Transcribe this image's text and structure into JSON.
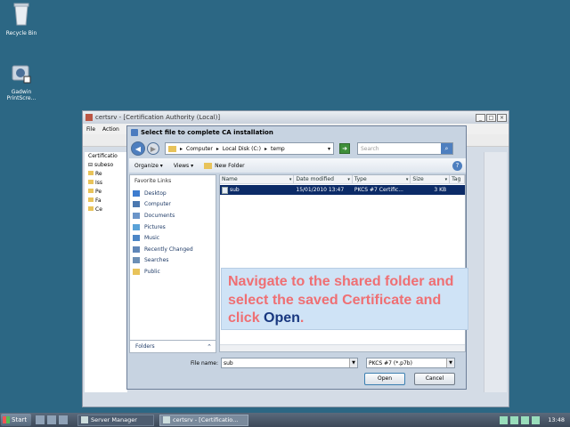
{
  "desktop": {
    "icons": [
      {
        "label": "Recycle Bin"
      },
      {
        "label": "Gadwin PrintScre..."
      }
    ]
  },
  "mmc": {
    "title": "certsrv - [Certification Authority (Local)]",
    "menu": [
      "File",
      "Action"
    ],
    "tree": [
      "Certificatio",
      "subeso",
      "Re",
      "Iss",
      "Pe",
      "Fa",
      "Ce"
    ]
  },
  "dialog": {
    "title": "Select file to complete CA installation",
    "breadcrumb": [
      "Computer",
      "Local Disk (C:)",
      "temp"
    ],
    "search_placeholder": "Search",
    "toolbar": {
      "organize": "Organize",
      "views": "Views",
      "new_folder": "New Folder"
    },
    "favorites_header": "Favorite Links",
    "favorites": [
      {
        "label": "Desktop",
        "icon": "desktop-icon",
        "color": "#3d7ccf"
      },
      {
        "label": "Computer",
        "icon": "computer-icon",
        "color": "#4b79b0"
      },
      {
        "label": "Documents",
        "icon": "documents-icon",
        "color": "#6b95c9"
      },
      {
        "label": "Pictures",
        "icon": "pictures-icon",
        "color": "#5aa2d8"
      },
      {
        "label": "Music",
        "icon": "music-icon",
        "color": "#4c86c6"
      },
      {
        "label": "Recently Changed",
        "icon": "recent-icon",
        "color": "#5f86b8"
      },
      {
        "label": "Searches",
        "icon": "searches-icon",
        "color": "#6c8fb5"
      },
      {
        "label": "Public",
        "icon": "folder-icon",
        "color": "#e8c35a"
      }
    ],
    "folders_label": "Folders",
    "columns": [
      "Name",
      "Date modified",
      "Type",
      "Size",
      "Tag"
    ],
    "files": [
      {
        "name": "sub",
        "date": "15/01/2010 13:47",
        "type": "PKCS #7 Certific...",
        "size": "3 KB",
        "tags": ""
      }
    ],
    "filename_label": "File name:",
    "filename_value": "sub",
    "filetype_value": "PKCS #7 (*.p7b)",
    "open_label": "Open",
    "cancel_label": "Cancel"
  },
  "callout": {
    "text_before": "Navigate to the shared folder and select the saved Certificate and click ",
    "highlight": "Open",
    "text_after": "."
  },
  "taskbar": {
    "start_label": "Start",
    "tasks": [
      "Server Manager",
      "certsrv - [Certificatio..."
    ],
    "clock": "13:48"
  }
}
